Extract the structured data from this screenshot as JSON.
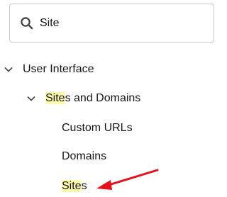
{
  "search": {
    "value": "Site",
    "icon": "search-icon"
  },
  "tree": {
    "user_interface": {
      "label": "User Interface"
    },
    "sites_and_domains": {
      "highlight": "Site",
      "rest": "s and Domains"
    },
    "custom_urls": {
      "label": "Custom URLs"
    },
    "domains": {
      "label": "Domains"
    },
    "sites": {
      "highlight": "Site",
      "rest": "s"
    }
  },
  "colors": {
    "highlight": "#fcf9a9",
    "annotation_arrow": "#e8101a"
  }
}
